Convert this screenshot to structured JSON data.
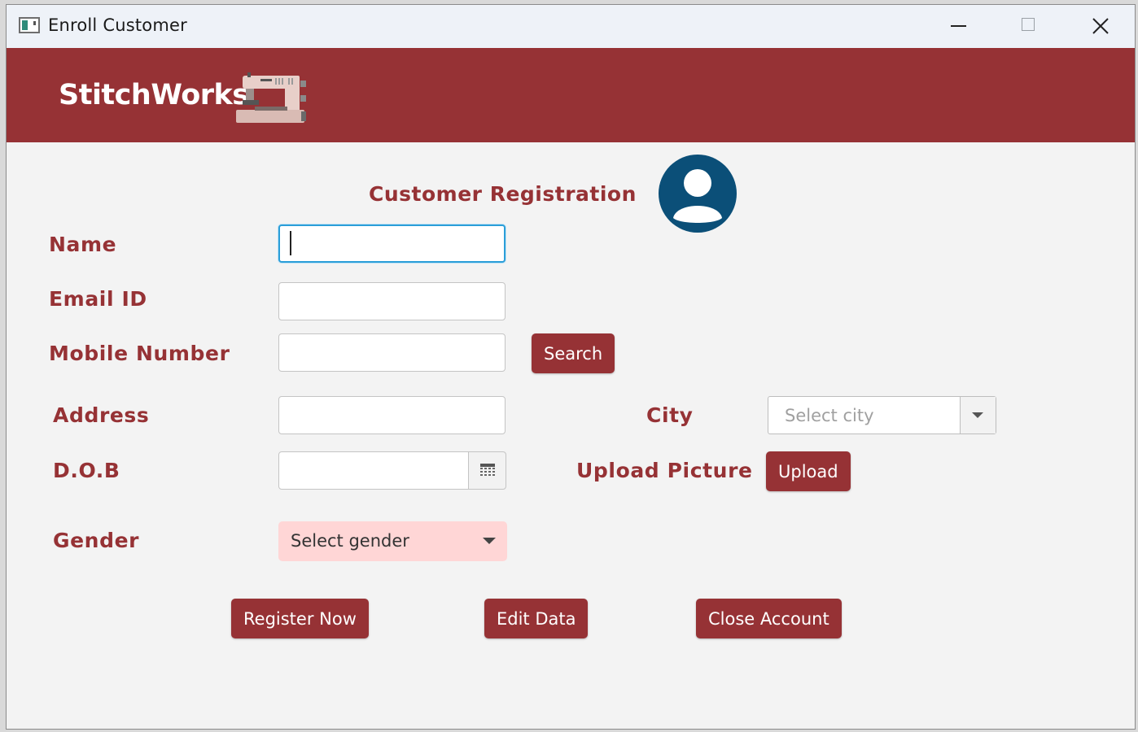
{
  "window": {
    "title": "Enroll Customer"
  },
  "header": {
    "brand": "StitchWorks",
    "logo_icon": "sewing-machine-icon"
  },
  "form": {
    "title": "Customer Registration",
    "avatar_icon": "user-avatar-icon",
    "labels": {
      "name": "Name",
      "email": "Email ID",
      "mobile": "Mobile Number",
      "address": "Address",
      "city": "City",
      "dob": "D.O.B",
      "upload": "Upload Picture",
      "gender": "Gender"
    },
    "values": {
      "name": "",
      "email": "",
      "mobile": "",
      "address": "",
      "dob": ""
    },
    "city_placeholder": "Select city",
    "gender_placeholder": "Select gender"
  },
  "buttons": {
    "search": "Search",
    "upload": "Upload",
    "register": "Register Now",
    "edit": "Edit Data",
    "close_account": "Close Account"
  },
  "colors": {
    "brand": "#963235",
    "focus": "#2b9ed8",
    "avatar": "#0b4f78",
    "gender_bg": "#ffd6d6"
  }
}
